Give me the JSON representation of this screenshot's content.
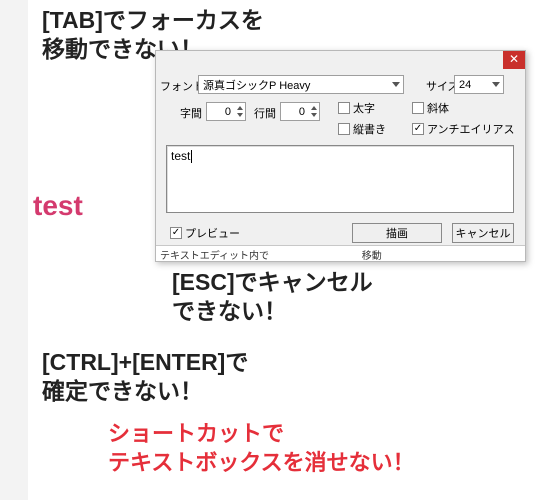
{
  "annotations": {
    "tab": "[TAB]でフォーカスを\n移動できない！",
    "esc": "[ESC]でキャンセル\nできない！",
    "ctrl": "[CTRL]+[ENTER]で\n確定できない！",
    "short": "ショートカットで\nテキストボックスを消せない！"
  },
  "preview_text": "test",
  "dialog": {
    "labels": {
      "font": "フォント名",
      "size": "サイズ",
      "kerning": "字間",
      "leading": "行間"
    },
    "values": {
      "font_name": "源真ゴシックP Heavy",
      "size": "24",
      "kerning": "0",
      "leading": "0",
      "text": "test"
    },
    "checkboxes": {
      "bold": {
        "label": "太字",
        "checked": false
      },
      "italic": {
        "label": "斜体",
        "checked": false
      },
      "vertical": {
        "label": "縦書き",
        "checked": false
      },
      "antialias": {
        "label": "アンチエイリアス",
        "checked": true
      },
      "preview": {
        "label": "プレビュー",
        "checked": true
      }
    },
    "buttons": {
      "draw": "描画",
      "cancel": "キャンセル"
    },
    "hint": "テキストエディット内で　　　　　　　　　 移動"
  }
}
